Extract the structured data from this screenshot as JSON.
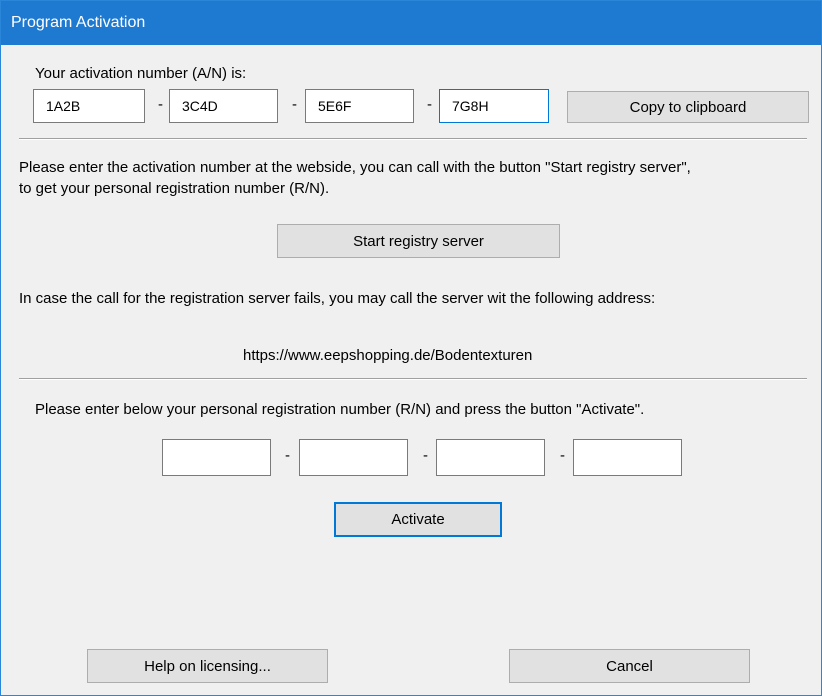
{
  "window": {
    "title": "Program Activation"
  },
  "activation": {
    "label": "Your activation number (A/N) is:",
    "parts": [
      "1A2B",
      "3C4D",
      "5E6F",
      "7G8H"
    ],
    "separator": "-",
    "copy_label": "Copy to clipboard"
  },
  "info": {
    "line1": "Please enter the activation number at the webside, you can call with the button \"Start registry server\",",
    "line2": "to get your personal registration number (R/N).",
    "start_label": "Start registry server",
    "fallback": "In case the call for the registration server fails, you may call the server wit the following address:",
    "url": "https://www.eepshopping.de/Bodentexturen"
  },
  "registration": {
    "label": "Please enter below your personal registration number (R/N) and press the button \"Activate\".",
    "parts": [
      "",
      "",
      "",
      ""
    ],
    "activate_label": "Activate"
  },
  "footer": {
    "help_label": "Help on licensing...",
    "cancel_label": "Cancel"
  },
  "colors": {
    "titlebar": "#1e79d0",
    "focus": "#0078d7",
    "button": "#e1e1e1"
  }
}
